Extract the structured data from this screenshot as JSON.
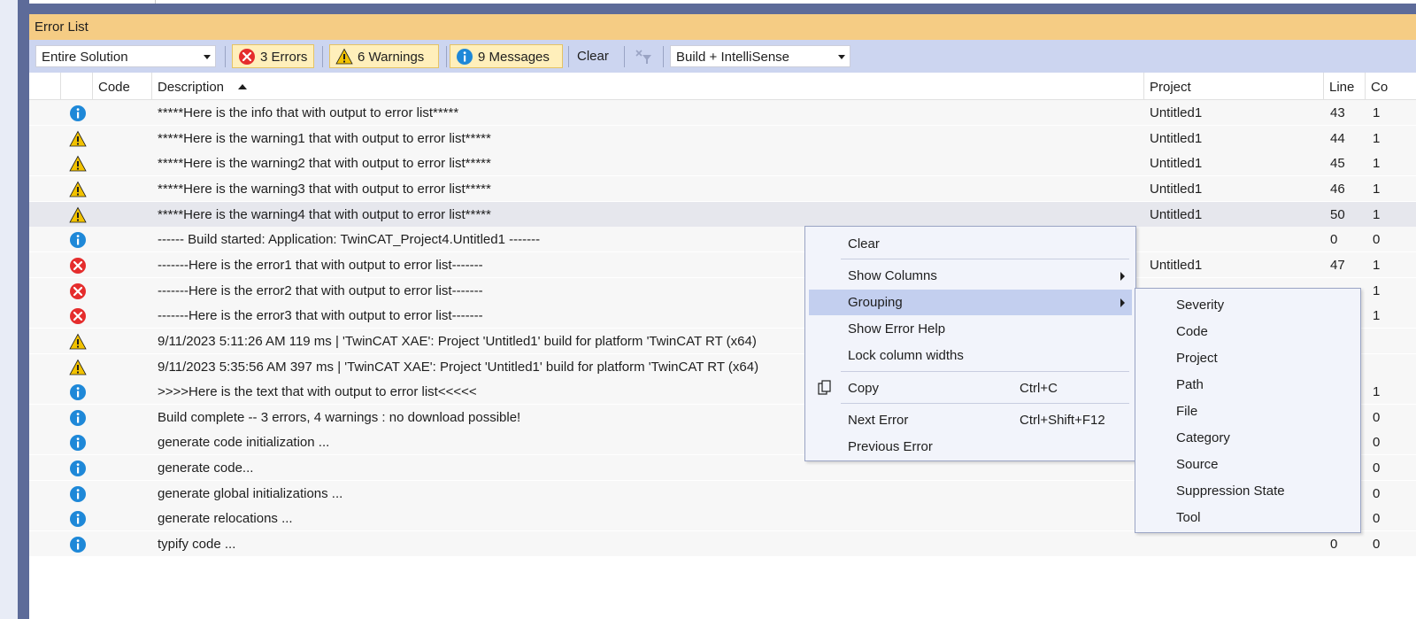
{
  "panel": {
    "title": "Error List"
  },
  "toolbar": {
    "scope": "Entire Solution",
    "errors": "3 Errors",
    "warnings": "6 Warnings",
    "messages": "9 Messages",
    "clear": "Clear",
    "source": "Build + IntelliSense"
  },
  "columns": {
    "code": "Code",
    "description": "Description",
    "project": "Project",
    "line": "Line",
    "col": "Co"
  },
  "rows": [
    {
      "severity": "info",
      "description": "*****Here is the info that with output to error list*****",
      "project": "Untitled1",
      "line": "43",
      "col": "1"
    },
    {
      "severity": "warning",
      "description": "*****Here is the warning1 that with output to error list*****",
      "project": "Untitled1",
      "line": "44",
      "col": "1"
    },
    {
      "severity": "warning",
      "description": "*****Here is the warning2 that with output to error list*****",
      "project": "Untitled1",
      "line": "45",
      "col": "1"
    },
    {
      "severity": "warning",
      "description": "*****Here is the warning3 that with output to error list*****",
      "project": "Untitled1",
      "line": "46",
      "col": "1"
    },
    {
      "severity": "warning",
      "description": "*****Here is the warning4 that with output to error list*****",
      "project": "Untitled1",
      "line": "50",
      "col": "1"
    },
    {
      "severity": "info",
      "description": "------ Build started: Application: TwinCAT_Project4.Untitled1 -------",
      "project": "",
      "line": "0",
      "col": "0"
    },
    {
      "severity": "error",
      "description": "-------Here is the error1 that with output to error list-------",
      "project": "Untitled1",
      "line": "47",
      "col": "1"
    },
    {
      "severity": "error",
      "description": "-------Here is the error2 that with output to error list-------",
      "project": "",
      "line": "",
      "col": "1"
    },
    {
      "severity": "error",
      "description": "-------Here is the error3 that with output to error list-------",
      "project": "",
      "line": "",
      "col": "1"
    },
    {
      "severity": "warning",
      "description": "9/11/2023 5:11:26 AM 119 ms | 'TwinCAT XAE': Project 'Untitled1' build for platform 'TwinCAT RT (x64)",
      "project": "",
      "line": "",
      "col": ""
    },
    {
      "severity": "warning",
      "description": "9/11/2023 5:35:56 AM 397 ms | 'TwinCAT XAE': Project 'Untitled1' build for platform 'TwinCAT RT (x64)",
      "project": "",
      "line": "",
      "col": ""
    },
    {
      "severity": "info",
      "description": ">>>>Here is the text that with output to error list<<<<<",
      "project": "",
      "line": "",
      "col": "1"
    },
    {
      "severity": "info",
      "description": "Build complete -- 3 errors, 4 warnings : no download possible!",
      "project": "",
      "line": "",
      "col": "0"
    },
    {
      "severity": "info",
      "description": "generate code initialization ...",
      "project": "",
      "line": "",
      "col": "0"
    },
    {
      "severity": "info",
      "description": "generate code...",
      "project": "",
      "line": "",
      "col": "0"
    },
    {
      "severity": "info",
      "description": "generate global initializations ...",
      "project": "",
      "line": "",
      "col": "0"
    },
    {
      "severity": "info",
      "description": "generate relocations ...",
      "project": "",
      "line": "",
      "col": "0"
    },
    {
      "severity": "info",
      "description": "typify code ...",
      "project": "",
      "line": "0",
      "col": "0"
    }
  ],
  "context_menu": {
    "clear": "Clear",
    "show_columns": "Show Columns",
    "grouping": "Grouping",
    "show_error_help": "Show Error Help",
    "lock_column_widths": "Lock column widths",
    "copy": "Copy",
    "copy_shortcut": "Ctrl+C",
    "next_error": "Next Error",
    "next_error_shortcut": "Ctrl+Shift+F12",
    "previous_error": "Previous Error"
  },
  "grouping_menu": [
    "Severity",
    "Code",
    "Project",
    "Path",
    "File",
    "Category",
    "Source",
    "Suppression State",
    "Tool"
  ],
  "colors": {
    "titlebar": "#f5cc84",
    "toolbar": "#ccd5f0",
    "frame": "#5d6b99",
    "info": "#1e88d8",
    "warning": "#f2c200",
    "error": "#e52d2d",
    "menu_highlight": "#c3cfef"
  },
  "icons": {
    "info": "info-icon",
    "warning": "warning-icon",
    "error": "error-icon",
    "filter": "filter-clear-icon",
    "copy": "copy-icon"
  }
}
